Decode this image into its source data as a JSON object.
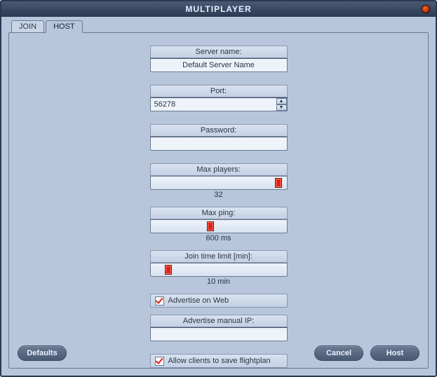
{
  "window": {
    "title": "MULTIPLAYER"
  },
  "tabs": {
    "join": "JOIN",
    "host": "HOST"
  },
  "server_name": {
    "label": "Server name:",
    "value": "Default Server Name"
  },
  "port": {
    "label": "Port:",
    "value": "56278"
  },
  "password": {
    "label": "Password:",
    "value": ""
  },
  "max_players": {
    "label": "Max players:",
    "value": "32",
    "slider_pos_pct": 94
  },
  "max_ping": {
    "label": "Max ping:",
    "value": "600 ms",
    "slider_pos_pct": 44
  },
  "join_time": {
    "label": "Join time limit [min]:",
    "value": "10 min",
    "slider_pos_pct": 13
  },
  "advertise_web": {
    "label": "Advertise on Web",
    "checked": true
  },
  "advertise_ip": {
    "label": "Advertise manual IP:",
    "value": ""
  },
  "allow_save": {
    "label": "Allow clients to save flightplan",
    "checked": true
  },
  "buttons": {
    "defaults": "Defaults",
    "cancel": "Cancel",
    "host": "Host"
  }
}
